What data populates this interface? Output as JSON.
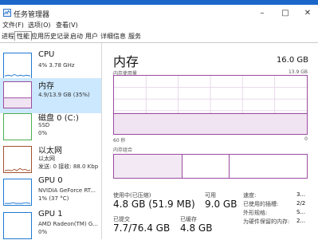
{
  "window": {
    "title": "任务管理器"
  },
  "menu": [
    "文件(F)",
    "选项(O)",
    "查看(V)"
  ],
  "tabs": [
    "进程",
    "性能",
    "应用历史记录",
    "启动",
    "用户",
    "详细信息",
    "服务"
  ],
  "active_tab_index": 1,
  "resources": [
    {
      "name": "CPU",
      "line1": "4% 3.78 GHz",
      "line2": "",
      "color": "#1f7ad1",
      "selected": false
    },
    {
      "name": "内存",
      "line1": "4.9/13.9 GB (35%)",
      "line2": "",
      "color": "#9b4ca0",
      "selected": true
    },
    {
      "name": "磁盘 0 (C:)",
      "line1": "SSD",
      "line2": "0%",
      "color": "#4caf50",
      "selected": false
    },
    {
      "name": "以太网",
      "line1": "以太网",
      "line2": "发送: 0 接收: 88.0 Kbp",
      "color": "#a0522d",
      "selected": false
    },
    {
      "name": "GPU 0",
      "line1": "NVIDIA GeForce RT...",
      "line2": "1% (37 °C)",
      "color": "#1f7ad1",
      "selected": false
    },
    {
      "name": "GPU 1",
      "line1": "AMD Radeon(TM) G...",
      "line2": "0%",
      "color": "#1f7ad1",
      "selected": false
    }
  ],
  "main": {
    "title": "内存",
    "total": "16.0 GB",
    "usage_label": "内存使用量",
    "usage_max": "13.9 GB",
    "time_left": "60 秒",
    "time_right": "0",
    "composition_label": "内存组合",
    "usage_fraction": 0.35
  },
  "stats": {
    "in_use_label": "使用中(已压缩)",
    "in_use_value": "4.8 GB (51.9 MB)",
    "available_label": "可用",
    "available_value": "9.0 GB",
    "committed_label": "已提交",
    "committed_value": "7.7/76.4 GB",
    "cached_label": "已缓存",
    "cached_value": "4.8 GB"
  },
  "info": [
    {
      "label": "速度:",
      "value": "3..."
    },
    {
      "label": "已使用的插槽:",
      "value": "2/2"
    },
    {
      "label": "外形规格:",
      "value": "S..."
    },
    {
      "label": "为硬件保留的内存:",
      "value": "2..."
    }
  ]
}
